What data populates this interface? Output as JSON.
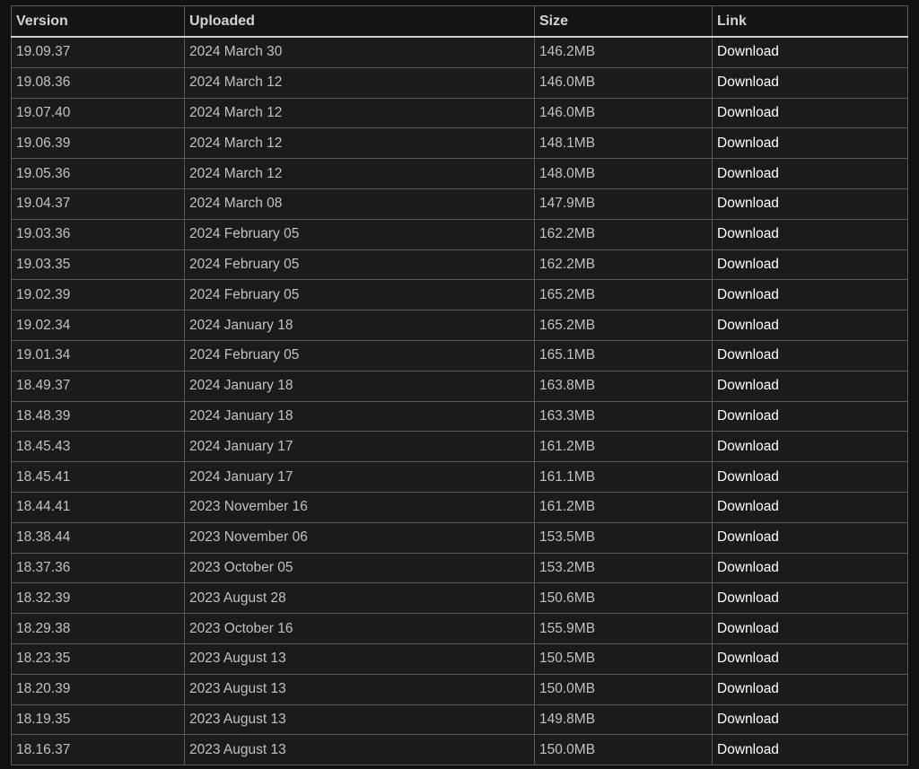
{
  "table": {
    "headers": [
      "Version",
      "Uploaded",
      "Size",
      "Link"
    ],
    "rows": [
      {
        "version": "19.09.37",
        "uploaded": "2024 March 30",
        "size": "146.2MB",
        "link": "Download"
      },
      {
        "version": "19.08.36",
        "uploaded": "2024 March 12",
        "size": "146.0MB",
        "link": "Download"
      },
      {
        "version": "19.07.40",
        "uploaded": "2024 March 12",
        "size": "146.0MB",
        "link": "Download"
      },
      {
        "version": "19.06.39",
        "uploaded": "2024 March 12",
        "size": "148.1MB",
        "link": "Download"
      },
      {
        "version": "19.05.36",
        "uploaded": "2024 March 12",
        "size": "148.0MB",
        "link": "Download"
      },
      {
        "version": "19.04.37",
        "uploaded": "2024 March 08",
        "size": "147.9MB",
        "link": "Download"
      },
      {
        "version": "19.03.36",
        "uploaded": "2024 February 05",
        "size": "162.2MB",
        "link": "Download"
      },
      {
        "version": "19.03.35",
        "uploaded": "2024 February 05",
        "size": "162.2MB",
        "link": "Download"
      },
      {
        "version": "19.02.39",
        "uploaded": "2024 February 05",
        "size": "165.2MB",
        "link": "Download"
      },
      {
        "version": "19.02.34",
        "uploaded": "2024 January 18",
        "size": "165.2MB",
        "link": "Download"
      },
      {
        "version": "19.01.34",
        "uploaded": "2024 February 05",
        "size": "165.1MB",
        "link": "Download"
      },
      {
        "version": "18.49.37",
        "uploaded": "2024 January 18",
        "size": "163.8MB",
        "link": "Download"
      },
      {
        "version": "18.48.39",
        "uploaded": "2024 January 18",
        "size": "163.3MB",
        "link": "Download"
      },
      {
        "version": "18.45.43",
        "uploaded": "2024 January 17",
        "size": "161.2MB",
        "link": "Download"
      },
      {
        "version": "18.45.41",
        "uploaded": "2024 January 17",
        "size": "161.1MB",
        "link": "Download"
      },
      {
        "version": "18.44.41",
        "uploaded": "2023 November 16",
        "size": "161.2MB",
        "link": "Download"
      },
      {
        "version": "18.38.44",
        "uploaded": "2023 November 06",
        "size": "153.5MB",
        "link": "Download"
      },
      {
        "version": "18.37.36",
        "uploaded": "2023 October 05",
        "size": "153.2MB",
        "link": "Download"
      },
      {
        "version": "18.32.39",
        "uploaded": "2023 August 28",
        "size": "150.6MB",
        "link": "Download"
      },
      {
        "version": "18.29.38",
        "uploaded": "2023 October 16",
        "size": "155.9MB",
        "link": "Download"
      },
      {
        "version": "18.23.35",
        "uploaded": "2023 August 13",
        "size": "150.5MB",
        "link": "Download"
      },
      {
        "version": "18.20.39",
        "uploaded": "2023 August 13",
        "size": "150.0MB",
        "link": "Download"
      },
      {
        "version": "18.19.35",
        "uploaded": "2023 August 13",
        "size": "149.8MB",
        "link": "Download"
      },
      {
        "version": "18.16.37",
        "uploaded": "2023 August 13",
        "size": "150.0MB",
        "link": "Download"
      }
    ]
  },
  "colors": {
    "background": "#111111",
    "table_background": "#1b1b1b",
    "border": "#5a5a5a",
    "text": "#c2c2c2",
    "link_text": "#ffffff"
  }
}
